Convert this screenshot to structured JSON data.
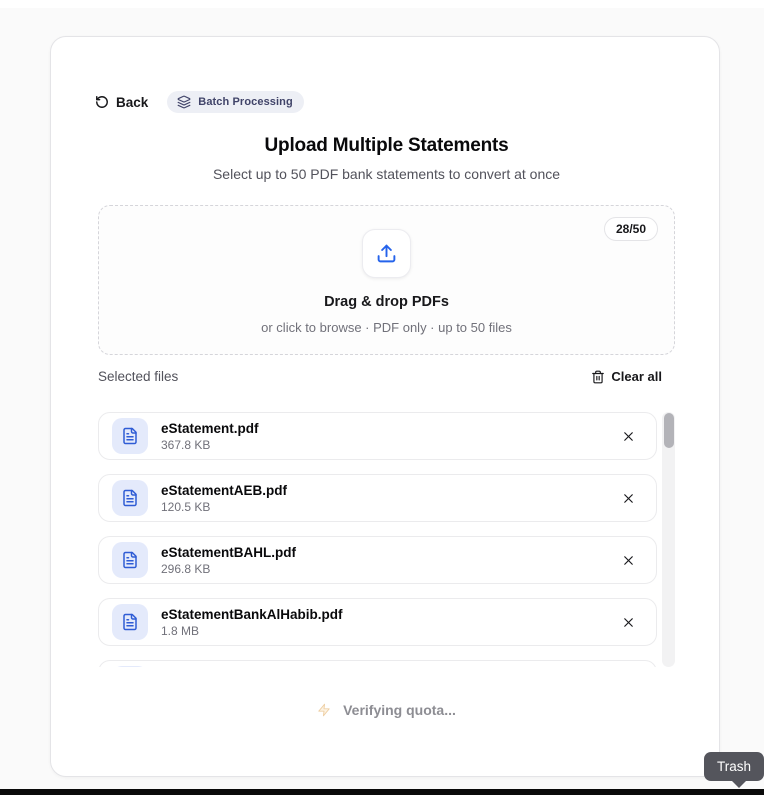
{
  "page": {
    "back_label": "Back",
    "badge_label": "Batch Processing",
    "title": "Upload Multiple Statements",
    "subtitle": "Select up to 50 PDF bank statements to convert at once"
  },
  "dropzone": {
    "count": "28/50",
    "headline": "Drag & drop PDFs",
    "subtext": "or click to browse · PDF only · up to 50 files"
  },
  "files": {
    "section_label": "Selected files",
    "clear_all_label": "Clear all",
    "items": [
      {
        "name": "eStatement.pdf",
        "size": "367.8 KB"
      },
      {
        "name": "eStatementAEB.pdf",
        "size": "120.5 KB"
      },
      {
        "name": "eStatementBAHL.pdf",
        "size": "296.8 KB"
      },
      {
        "name": "eStatementBankAlHabib.pdf",
        "size": "1.8 MB"
      }
    ],
    "partial_row": true
  },
  "footer": {
    "status": "Verifying quota..."
  },
  "tooltip": {
    "label": "Trash"
  },
  "colors": {
    "accent_blue": "#2563eb",
    "badge_text": "#414469",
    "tooltip_bg": "#54555c"
  }
}
